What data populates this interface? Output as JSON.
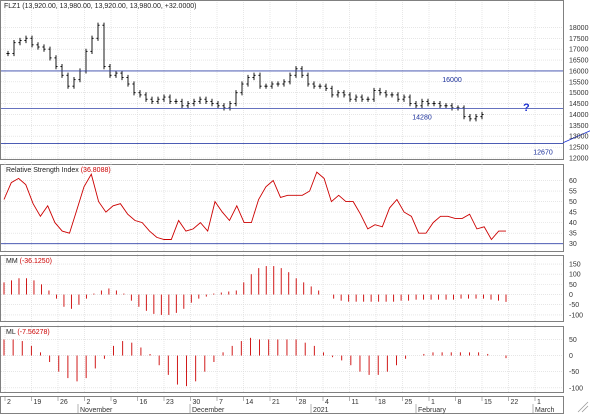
{
  "chart_data": [
    {
      "type": "bar",
      "style": "ohlc",
      "title": "FLZ1 (13,920.00, 13,980.00, 13,920.00, 13,980.00, +32.0000)",
      "ylim": [
        12000,
        18800
      ],
      "yticks": [
        12000,
        12500,
        13000,
        13500,
        14000,
        14500,
        15000,
        15500,
        16000,
        16500,
        17000,
        17500,
        18000
      ],
      "hlines": [
        {
          "value": 16000,
          "label": "16000"
        },
        {
          "value": 14280,
          "label": "14280"
        },
        {
          "value": 12670,
          "label": "12670"
        }
      ],
      "trendline": {
        "from": [
          104,
          14100
        ],
        "to": [
          116,
          12700
        ]
      },
      "annotation": "?",
      "close": [
        16800,
        17300,
        17400,
        17500,
        17200,
        17100,
        17000,
        16600,
        16200,
        15800,
        15300,
        15600,
        16000,
        16900,
        17500,
        18100,
        16200,
        15800,
        15900,
        15700,
        15400,
        15000,
        14900,
        14700,
        14600,
        14700,
        14800,
        14600,
        14600,
        14400,
        14500,
        14600,
        14700,
        14600,
        14500,
        14400,
        14300,
        14500,
        15000,
        15400,
        15700,
        15800,
        15300,
        15300,
        15400,
        15400,
        15500,
        15800,
        16100,
        15800,
        15400,
        15300,
        15300,
        15200,
        14900,
        15000,
        14900,
        14700,
        14800,
        14700,
        14700,
        15100,
        15000,
        14900,
        14900,
        14700,
        14800,
        14500,
        14400,
        14600,
        14500,
        14500,
        14400,
        14400,
        14300,
        14300,
        13900,
        13800,
        13900,
        14000
      ],
      "grid": true
    },
    {
      "type": "line",
      "title": "Relative Strength Index",
      "value_label": "(36.8088)",
      "ylim": [
        27,
        65
      ],
      "yticks": [
        30,
        35,
        40,
        45,
        50,
        55,
        60
      ],
      "hlines": [
        {
          "value": 30
        }
      ],
      "values": [
        51,
        59,
        61,
        58,
        49,
        43,
        48,
        40,
        36,
        35,
        46,
        57,
        63,
        50,
        45,
        48,
        49,
        44,
        41,
        40,
        36,
        33,
        32,
        32,
        41,
        36,
        37,
        40,
        36,
        50,
        45,
        41,
        48,
        40,
        40,
        51,
        57,
        60,
        52,
        53,
        53,
        53,
        55,
        64,
        61,
        50,
        53,
        50,
        50,
        44,
        37,
        39,
        38,
        47,
        51,
        45,
        43,
        35,
        35,
        40,
        43,
        43,
        42,
        42,
        44,
        37,
        38,
        32,
        36,
        36
      ],
      "line_color": "#cc0000",
      "grid": true
    },
    {
      "type": "bar",
      "title": "MM",
      "value_label": "(-36.1250)",
      "ylim": [
        -125,
        160
      ],
      "yticks": [
        -100,
        -50,
        0,
        50,
        100,
        150
      ],
      "values": [
        60,
        70,
        80,
        80,
        70,
        50,
        20,
        -20,
        -60,
        -70,
        -50,
        -20,
        5,
        20,
        30,
        20,
        5,
        -30,
        -60,
        -80,
        -95,
        -100,
        -100,
        -90,
        -70,
        -40,
        -20,
        -10,
        5,
        10,
        15,
        20,
        60,
        100,
        130,
        140,
        140,
        130,
        110,
        80,
        60,
        40,
        20,
        0,
        -20,
        -30,
        -35,
        -35,
        -35,
        -35,
        -35,
        -35,
        -35,
        -30,
        -30,
        -25,
        -25,
        -25,
        -25,
        -25,
        -25,
        -20,
        -20,
        -20,
        -20,
        -25,
        -30,
        -36
      ],
      "bar_color": "#cc0000",
      "grid": true
    },
    {
      "type": "bar",
      "title": "ML",
      "value_label": "(-7.56278)",
      "ylim": [
        -110,
        70
      ],
      "yticks": [
        -100,
        -50,
        0,
        50
      ],
      "values": [
        50,
        50,
        45,
        30,
        10,
        -20,
        -50,
        -70,
        -80,
        -70,
        -40,
        -10,
        30,
        45,
        40,
        25,
        5,
        -30,
        -60,
        -90,
        -95,
        -80,
        -50,
        -20,
        10,
        30,
        45,
        55,
        50,
        50,
        50,
        50,
        50,
        40,
        30,
        10,
        -5,
        -15,
        -30,
        -50,
        -60,
        -60,
        -50,
        -30,
        -10,
        0,
        5,
        10,
        10,
        10,
        10,
        10,
        10,
        5,
        0,
        -8
      ],
      "bar_color": "#cc0000",
      "grid": true
    }
  ],
  "x_axis": {
    "day_ticks": [
      "2",
      "19",
      "26",
      "2",
      "9",
      "16",
      "23",
      "30",
      "7",
      "14",
      "21",
      "28",
      "4",
      "11",
      "18",
      "25",
      "1",
      "8",
      "15",
      "22",
      "1"
    ],
    "month_labels": [
      "November",
      "December",
      "2021",
      "February",
      "March"
    ]
  }
}
